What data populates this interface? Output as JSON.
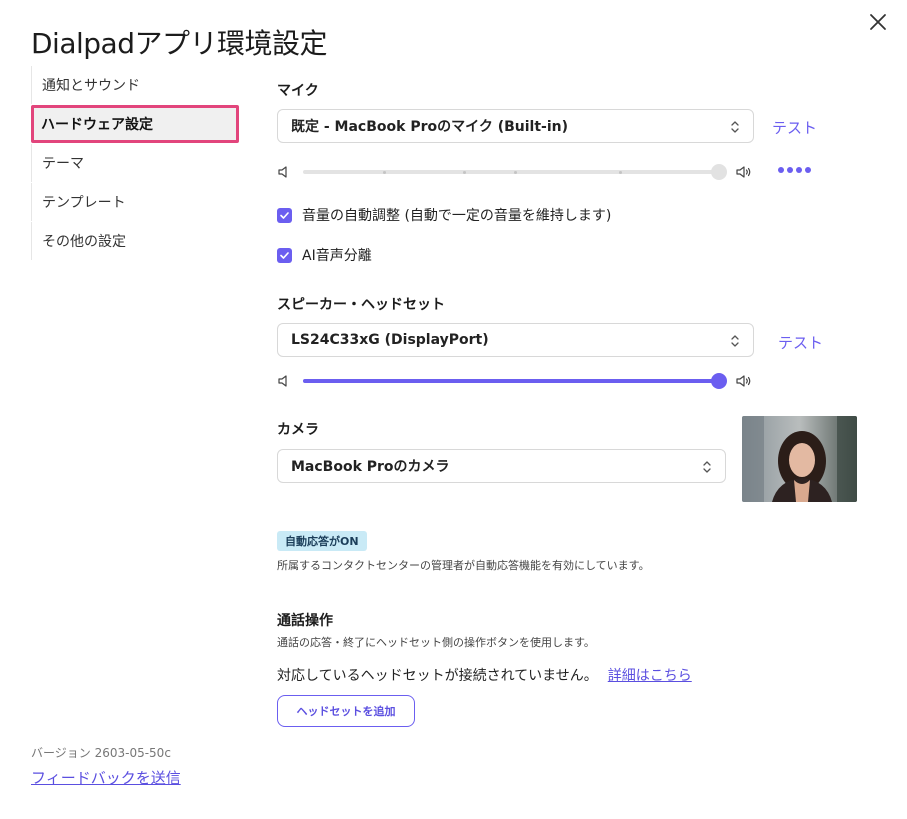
{
  "window": {
    "title": "Dialpadアプリ環境設定",
    "close_icon": "close-icon"
  },
  "sidebar": {
    "items": [
      {
        "label": "通知とサウンド",
        "active": false
      },
      {
        "label": "ハードウェア設定",
        "active": true
      },
      {
        "label": "テーマ",
        "active": false
      },
      {
        "label": "テンプレート",
        "active": false
      },
      {
        "label": "その他の設定",
        "active": false
      }
    ],
    "version": "バージョン 2603-05-50c",
    "feedback_label": "フィードバックを送信"
  },
  "mic": {
    "label": "マイク",
    "selected": "既定 - MacBook Proのマイク (Built-in)",
    "test_label": "テスト",
    "volume": 1.0,
    "auto_adjust_label": "音量の自動調整 (自動で一定の音量を維持します)",
    "auto_adjust_checked": true,
    "ai_separation_label": "AI音声分離",
    "ai_separation_checked": true
  },
  "speaker": {
    "label": "スピーカー・ヘッドセット",
    "selected": "LS24C33xG (DisplayPort)",
    "test_label": "テスト",
    "volume": 1.0
  },
  "camera": {
    "label": "カメラ",
    "selected": "MacBook Proのカメラ"
  },
  "auto_answer": {
    "badge": "自動応答がON",
    "description": "所属するコンタクトセンターの管理者が自動応答機能を有効にしています。"
  },
  "call_controls": {
    "title": "通話操作",
    "description": "通話の応答・終了にヘッドセット側の操作ボタンを使用します。",
    "status": "対応しているヘッドセットが接続されていません。",
    "detail_link": "詳細はこちら",
    "add_button": "ヘッドセットを追加"
  },
  "colors": {
    "accent": "#6b5ef0",
    "highlight_border": "#e2457c",
    "badge_bg": "#c9eaf6"
  }
}
